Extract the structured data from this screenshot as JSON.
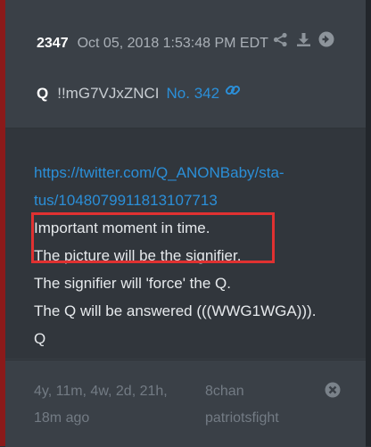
{
  "post": {
    "number": "2347",
    "timestamp": "Oct 05, 2018 1:53:48 PM EDT",
    "author": "Q",
    "tripcode": "!!mG7VJxZNCI",
    "post_ref": "No. 342"
  },
  "message": {
    "link_line1": "https://twitter.com/Q_ANONBaby/sta-",
    "link_line2": "tus/1048079911813107713",
    "lines": [
      "Important moment in time.",
      "The picture will be the signifier.",
      "The signifier will 'force' the Q.",
      "The Q will be answered (((WWG1WGA))).",
      "Q"
    ]
  },
  "footer": {
    "elapsed_line1": "4y, 11m, 4w, 2d, 21h,",
    "elapsed_line2": "18m ago",
    "board_line1": "8chan",
    "board_line2": "patriotsfight"
  },
  "icons": {
    "share": "share-icon",
    "download": "download-icon",
    "go": "arrow-right-circle-icon",
    "link": "link-icon",
    "close": "close-circle-icon"
  },
  "colors": {
    "accent_link": "#2b8fd8",
    "highlight": "#e03131",
    "left_edge": "#8b1a1a"
  }
}
